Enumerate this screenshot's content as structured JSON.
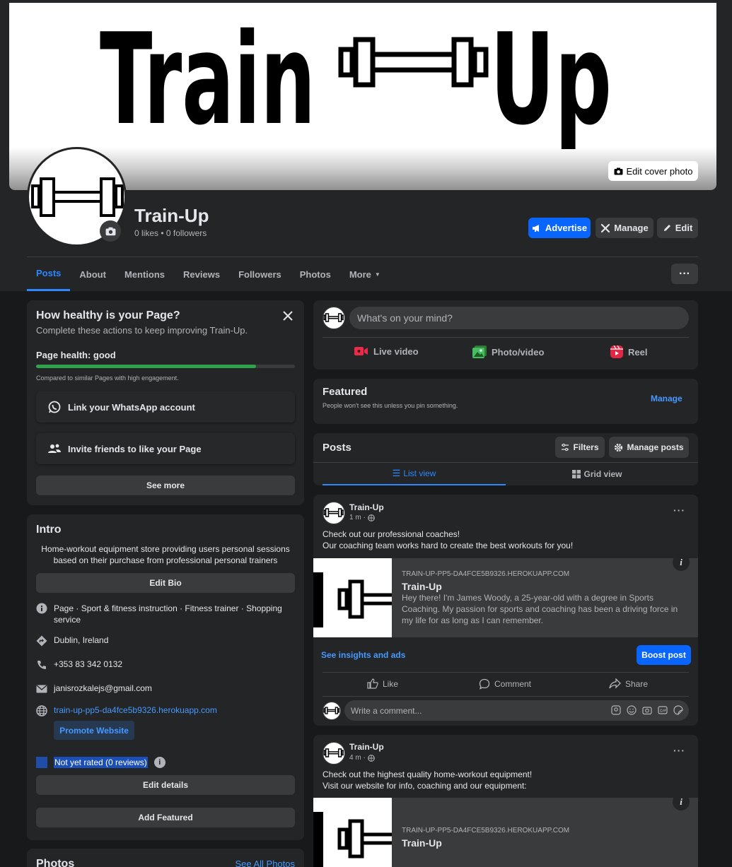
{
  "cover": {
    "logo_left": "Train",
    "logo_right": "Up",
    "edit_label": "Edit cover photo"
  },
  "page": {
    "name": "Train-Up",
    "stats": "0 likes • 0 followers"
  },
  "actions": {
    "advertise": "Advertise",
    "manage": "Manage",
    "edit": "Edit"
  },
  "tabs": [
    "Posts",
    "About",
    "Mentions",
    "Reviews",
    "Followers",
    "Photos",
    "More"
  ],
  "health": {
    "title": "How healthy is your Page?",
    "subtitle": "Complete these actions to keep improving Train-Up.",
    "status": "Page health: good",
    "progress": 0.85,
    "compare": "Compared to similar Pages with high engagement.",
    "item1": "Link your WhatsApp account",
    "item2": "Invite friends to like your Page",
    "see_more": "See more"
  },
  "intro": {
    "title": "Intro",
    "bio": "Home-workout equipment store providing users personal sessions based on their purchase from professional personal trainers",
    "edit_bio": "Edit Bio",
    "category": "Page · Sport & fitness instruction · Fitness trainer · Shopping service",
    "location": "Dublin, Ireland",
    "phone": "+353 83 342 0132",
    "email": "janisrozkalejs@gmail.com",
    "website": "train-up-pp5-da4fce5b9326.herokuapp.com",
    "promote": "Promote Website",
    "rating": "Not yet rated (0 reviews)",
    "edit_details": "Edit details",
    "add_featured": "Add Featured"
  },
  "photos": {
    "title": "Photos",
    "see_all": "See All Photos"
  },
  "composer": {
    "placeholder": "What's on your mind?",
    "live": "Live video",
    "photo": "Photo/video",
    "reel": "Reel"
  },
  "featured": {
    "title": "Featured",
    "subtitle": "People won't see this unless you pin something.",
    "manage": "Manage"
  },
  "posts_header": {
    "title": "Posts",
    "filters": "Filters",
    "manage_posts": "Manage posts",
    "list_view": "List view",
    "grid_view": "Grid view"
  },
  "post1": {
    "author": "Train-Up",
    "time": "1 m ·",
    "line1": "Check out our professional coaches!",
    "line2": "Our coaching team works hard to create the best workouts for you!",
    "domain": "TRAIN-UP-PP5-DA4FCE5B9326.HEROKUAPP.COM",
    "link_title": "Train-Up",
    "link_desc": "Hey there! I'm James Woody, a 25-year-old with a degree in Sports Coaching. My passion for sports and coaching has been a driving force in my life for as long as I can remember.",
    "insights": "See insights and ads",
    "boost": "Boost post",
    "like": "Like",
    "comment": "Comment",
    "share": "Share",
    "comment_placeholder": "Write a comment..."
  },
  "post2": {
    "author": "Train-Up",
    "time": "4 m ·",
    "line1": "Check out the highest quality home-workout equipment!",
    "line2": "Visit our website for info, coaching and our equipment:",
    "domain": "TRAIN-UP-PP5-DA4FCE5B9326.HEROKUAPP.COM",
    "link_title": "Train-Up"
  },
  "colors": {
    "accent": "#0866ff",
    "link": "#4599ff",
    "health_bar": "#31a24c",
    "background": "#18191a",
    "card": "#242526"
  }
}
